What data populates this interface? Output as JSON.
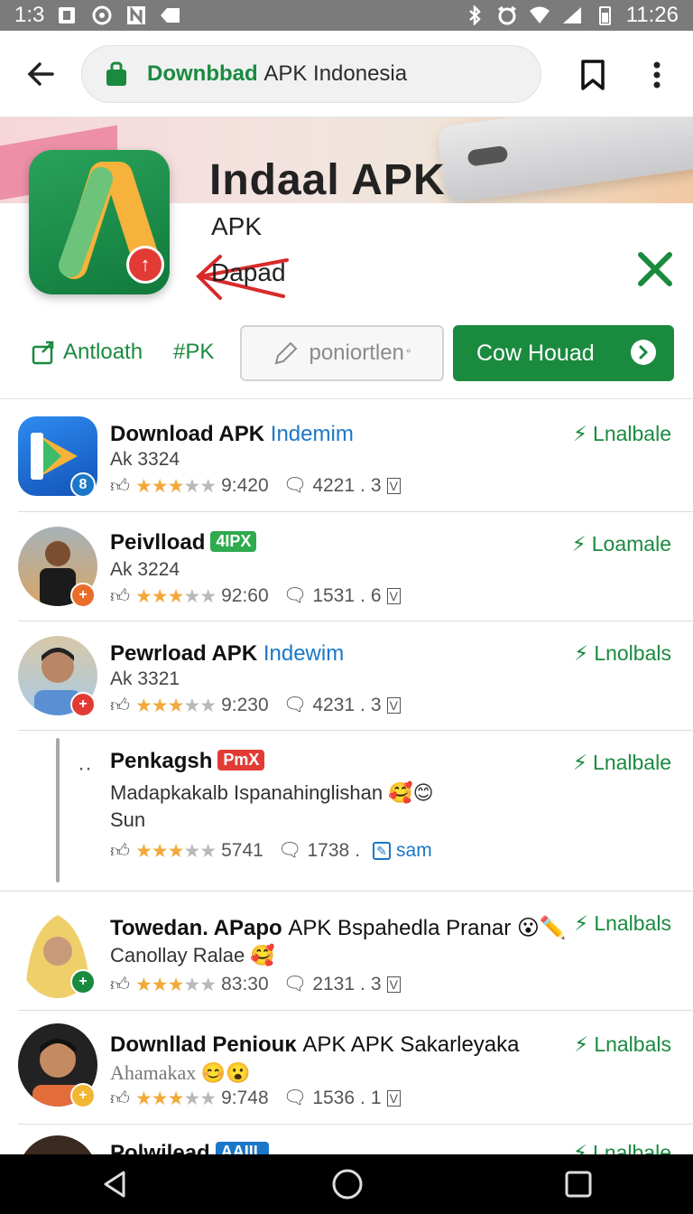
{
  "status_bar": {
    "time_left": "1:3",
    "time_right": "11:26"
  },
  "browser": {
    "url_highlight": "Downbbad",
    "url_rest": "APK Indonesia"
  },
  "hero": {
    "title": "Indaal APK",
    "subtitle1": "APK",
    "subtitle2": "Dapad"
  },
  "actions": {
    "link1": "Antloath",
    "link2": "#PK",
    "outline_button": "poniortlen",
    "outline_button_sup": "°",
    "primary_button": "Cow Houad"
  },
  "list": [
    {
      "title_bold": "Download APK",
      "title_blue": "Indemim",
      "subtitle": "Ak 3324",
      "rating_text": "9:420",
      "count": "4221",
      "version": "3",
      "install": "Lnalbale"
    },
    {
      "title_bold": "Peivlload",
      "tag": "4IPX",
      "tag_color": "#2faa4f",
      "subtitle": "Ak 3224",
      "rating_text": "92:60",
      "count": "1531",
      "version": "6",
      "install": "Loamale"
    },
    {
      "title_bold": "Pewrload APK",
      "title_blue": "Indewim",
      "subtitle": "Ak 3321",
      "rating_text": "9:230",
      "count": "4231",
      "version": "3",
      "install": "Lnolbals"
    },
    {
      "title_bold": "Penkagsh",
      "tag": "PmX",
      "tag_color": "#e23b35",
      "subtitle": "Madapkakalb Ispanahinglishan",
      "subtitle_line2": "Sun",
      "rating_text": "5741",
      "count": "1738",
      "link": "sam",
      "install": "Lnalbale"
    },
    {
      "title_bold": "Towedan. APapo",
      "title_tail": "APK Bspahedla Pranar",
      "subtitle": "Canollay Ralae",
      "rating_text": "83:30",
      "count": "2131",
      "version": "3",
      "install": "Lnalbals"
    },
    {
      "title_bold": "Downllad Peniouĸ",
      "title_tail": "APK APK Sakarleyaka",
      "subtitle": "Ahamakax",
      "rating_text": "9:748",
      "count": "1536",
      "version": "1",
      "install": "Lnalbals"
    },
    {
      "title_bold": "Polwilead",
      "tag": "AAIIL",
      "tag_color": "#1b77c7",
      "install": "Lnalbale"
    }
  ],
  "colors": {
    "accent_green": "#1a8a3f",
    "link_blue": "#1b77c7",
    "star": "#f2a93b",
    "badge_red": "#e23b35"
  }
}
